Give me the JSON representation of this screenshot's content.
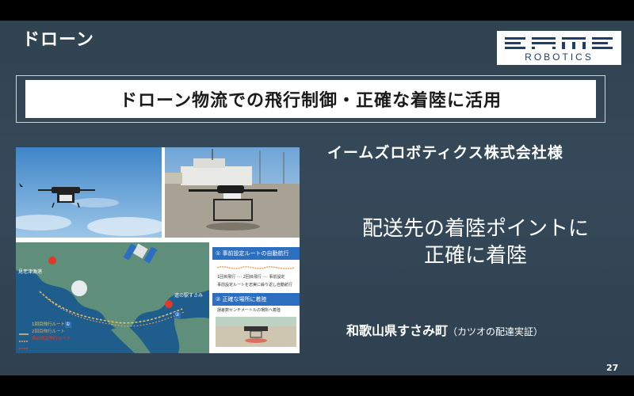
{
  "slide": {
    "title": "ドローン",
    "banner": "ドローン物流での飛行制御・正確な着陸に活用",
    "company": "イームズロボティクス株式会社様",
    "message_line1": "配送先の着陸ポイントに",
    "message_line2": "正確に着陸",
    "place": "和歌山県すさみ町",
    "place_note": "（カツオの配達実証）",
    "page_number": "27"
  },
  "logo": {
    "brand": "EAME",
    "sub": "ROBOTICS",
    "color": "#1e3f6e"
  },
  "figure": {
    "map_labels": {
      "port": "見老津漁港",
      "station": "道の駅すさみ",
      "marker1": "①",
      "marker2": "②"
    },
    "legend": [
      "1回目飛行ルート",
      "2回目飛行ルート",
      "事前設定飛行ルート"
    ],
    "info": {
      "step1": "① 事前設定ルートの自動航行",
      "step1_legend": "1回目飛行  ····  2回目飛行  ····  事前設定",
      "step1_note": "事前設定ルートを忠実に繰り返し自動航行",
      "step2": "② 正確な場所に着陸",
      "step2_note": "誤差数センチメートルの場所へ着陸"
    }
  },
  "colors": {
    "slide_bg": "#33475a",
    "accent_blue": "#2c6fc0",
    "marker_red": "#e0392b"
  }
}
